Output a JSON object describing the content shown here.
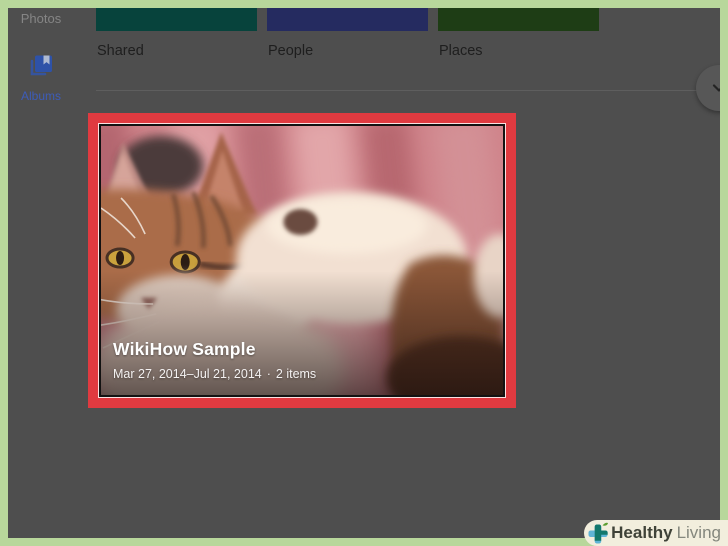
{
  "sidebar": {
    "photos_label": "Photos",
    "albums_label": "Albums"
  },
  "collections": [
    {
      "label": "Shared",
      "color": "#07433c"
    },
    {
      "label": "People",
      "color": "#252b60"
    },
    {
      "label": "Places",
      "color": "#1e3d15"
    }
  ],
  "album": {
    "title": "WikiHow Sample",
    "date_range": "Mar 27, 2014–Jul 21, 2014",
    "separator": "·",
    "item_count": "2 items",
    "highlight_color": "#e03a40"
  },
  "watermark": {
    "bold": "Healthy",
    "regular": "Living"
  },
  "icons": {
    "albums": "book-with-bookmark",
    "chevron": "chevron-down",
    "watermark": "health-cross-with-leaf"
  },
  "colors": {
    "background": "#4e4e4e",
    "frame_border": "#b8d79b",
    "divider": "#5e5e5e",
    "accent_blue": "#3d5cb8"
  }
}
